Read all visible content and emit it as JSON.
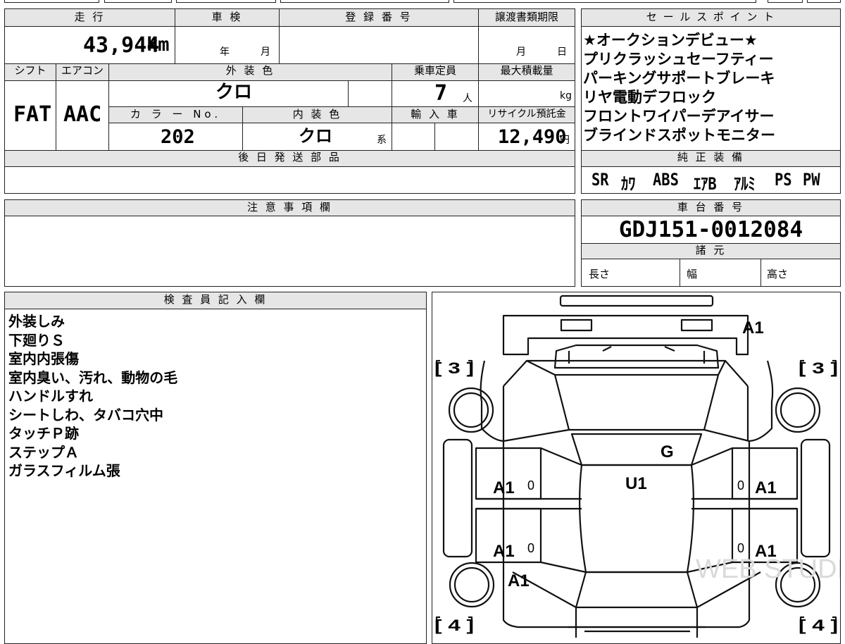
{
  "mileage": {
    "label": "走 行",
    "value": "43,944",
    "unit": "km"
  },
  "shaken": {
    "label": "車 検",
    "year_unit": "年",
    "month_unit": "月"
  },
  "registration": {
    "label": "登 録 番 号",
    "value": ""
  },
  "transfer_deadline": {
    "label": "譲渡書類期限",
    "month_unit": "月",
    "day_unit": "日"
  },
  "sales_points": {
    "label": "セ ー ル ス ポ イ ン ト",
    "lines": [
      "★オークションデビュー★",
      "プリクラッシュセーフティー",
      "パーキングサポートブレーキ",
      "リヤ電動デフロック",
      "フロントワイパーデアイサー",
      "ブラインドスポットモニター"
    ]
  },
  "shift": {
    "label": "シフト",
    "value": "FAT"
  },
  "aircon": {
    "label": "エアコン",
    "value": "AAC"
  },
  "exterior_color": {
    "label": "外 装 色",
    "value": "クロ"
  },
  "capacity": {
    "label": "乗車定員",
    "value": "7",
    "unit": "人"
  },
  "max_load": {
    "label": "最大積載量",
    "unit": "kg"
  },
  "color_no": {
    "label": "カ ラ ー No.",
    "value": "202"
  },
  "interior_color": {
    "label": "内 装 色",
    "value": "クロ",
    "suffix": "系"
  },
  "import_car": {
    "label": "輸 入 車"
  },
  "recycle_fee": {
    "label": "リサイクル預託金",
    "value": "12,490",
    "unit": "円"
  },
  "later_parts": {
    "label": "後 日 発 送 部 品"
  },
  "genuine_equipment": {
    "label": "純 正 装 備",
    "items": [
      "SR",
      "ｶﾜ",
      "ABS",
      "ｴｱB",
      "ｱﾙﾐ",
      "PS",
      "PW"
    ]
  },
  "notes": {
    "label": "注 意 事 項 欄"
  },
  "chassis": {
    "label": "車 台 番 号",
    "value": "GDJ151-0012084"
  },
  "specs": {
    "label": "諸 元",
    "length_label": "長さ",
    "width_label": "幅",
    "height_label": "高さ"
  },
  "inspector": {
    "label": "検 査 員 記 入 欄",
    "lines": [
      "外装しみ",
      "下廻りＳ",
      "室内内張傷",
      "室内臭い、汚れ、動物の毛",
      "ハンドルすれ",
      "シートしわ、タバコ穴中",
      "タッチＰ跡",
      "ステップＡ",
      "ガラスフィルム張"
    ]
  },
  "diagram": {
    "marks": {
      "rear_top": "A1",
      "roof_g": "G",
      "roof_u1": "U1",
      "left_upper": "A1",
      "left_lower": "A1",
      "right_upper": "A1",
      "right_lower": "A1",
      "front_left": "A1"
    },
    "zero_marks": [
      "0",
      "0",
      "0",
      "0"
    ],
    "corners": {
      "top_left": "[ 3 ]",
      "top_right": "[ 3 ]",
      "bottom_left": "[ 4 ]",
      "bottom_right": "[ 4 ]"
    },
    "watermark": "WEB STUDIO PRO"
  }
}
